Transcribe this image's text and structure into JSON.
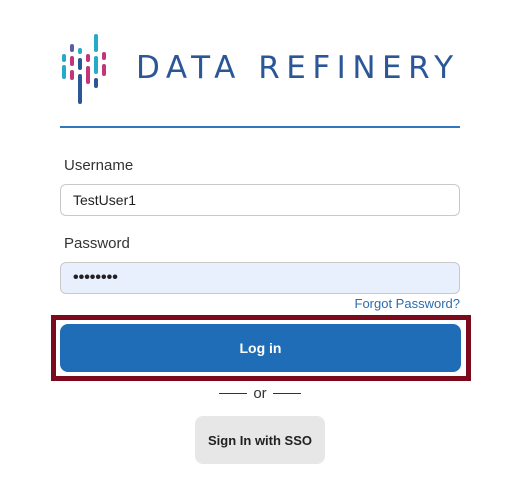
{
  "brand": {
    "name": "DATA REFINERY",
    "text_color": "#2b5797",
    "mark_colors": [
      "#27a9c9",
      "#c2357a",
      "#2b5797",
      "#5b5ea6"
    ]
  },
  "form": {
    "username_label": "Username",
    "username_value": "TestUser1",
    "password_label": "Password",
    "password_value": "••••••••",
    "forgot_password_link": "Forgot Password?",
    "login_button": "Log in",
    "separator_text": "or",
    "sso_button": "Sign In with SSO"
  },
  "colors": {
    "primary": "#1f6db7",
    "highlight_border": "#7a0a1c",
    "autofill_bg": "#e8f0fe"
  }
}
